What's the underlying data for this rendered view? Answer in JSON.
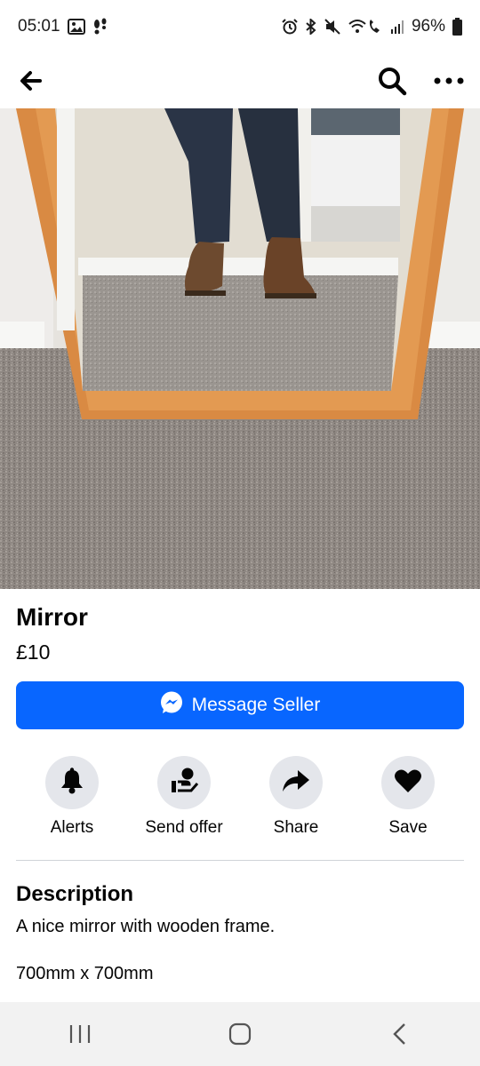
{
  "status_bar": {
    "time": "05:01",
    "battery": "96%",
    "left_icons": [
      "gallery-icon",
      "voicemail-icon"
    ],
    "right_icons": [
      "alarm-icon",
      "bluetooth-icon",
      "mute-icon",
      "wifi-call-icon",
      "signal-icon",
      "battery-icon"
    ]
  },
  "app_bar": {
    "back_icon": "arrow-left-icon",
    "search_icon": "search-icon",
    "more_icon": "more-icon"
  },
  "listing": {
    "title": "Mirror",
    "price": "£10",
    "message_button": "Message Seller"
  },
  "actions": [
    {
      "label": "Alerts",
      "icon": "bell-icon"
    },
    {
      "label": "Send offer",
      "icon": "offer-icon"
    },
    {
      "label": "Share",
      "icon": "share-icon"
    },
    {
      "label": "Save",
      "icon": "heart-icon"
    }
  ],
  "description": {
    "heading": "Description",
    "text": "A nice mirror with wooden frame.",
    "dimensions": "700mm x 700mm"
  },
  "colors": {
    "accent": "#0866ff",
    "action_circle": "#e4e6eb"
  },
  "nav_bar": {
    "buttons": [
      "recents-icon",
      "home-icon",
      "back-icon"
    ]
  }
}
